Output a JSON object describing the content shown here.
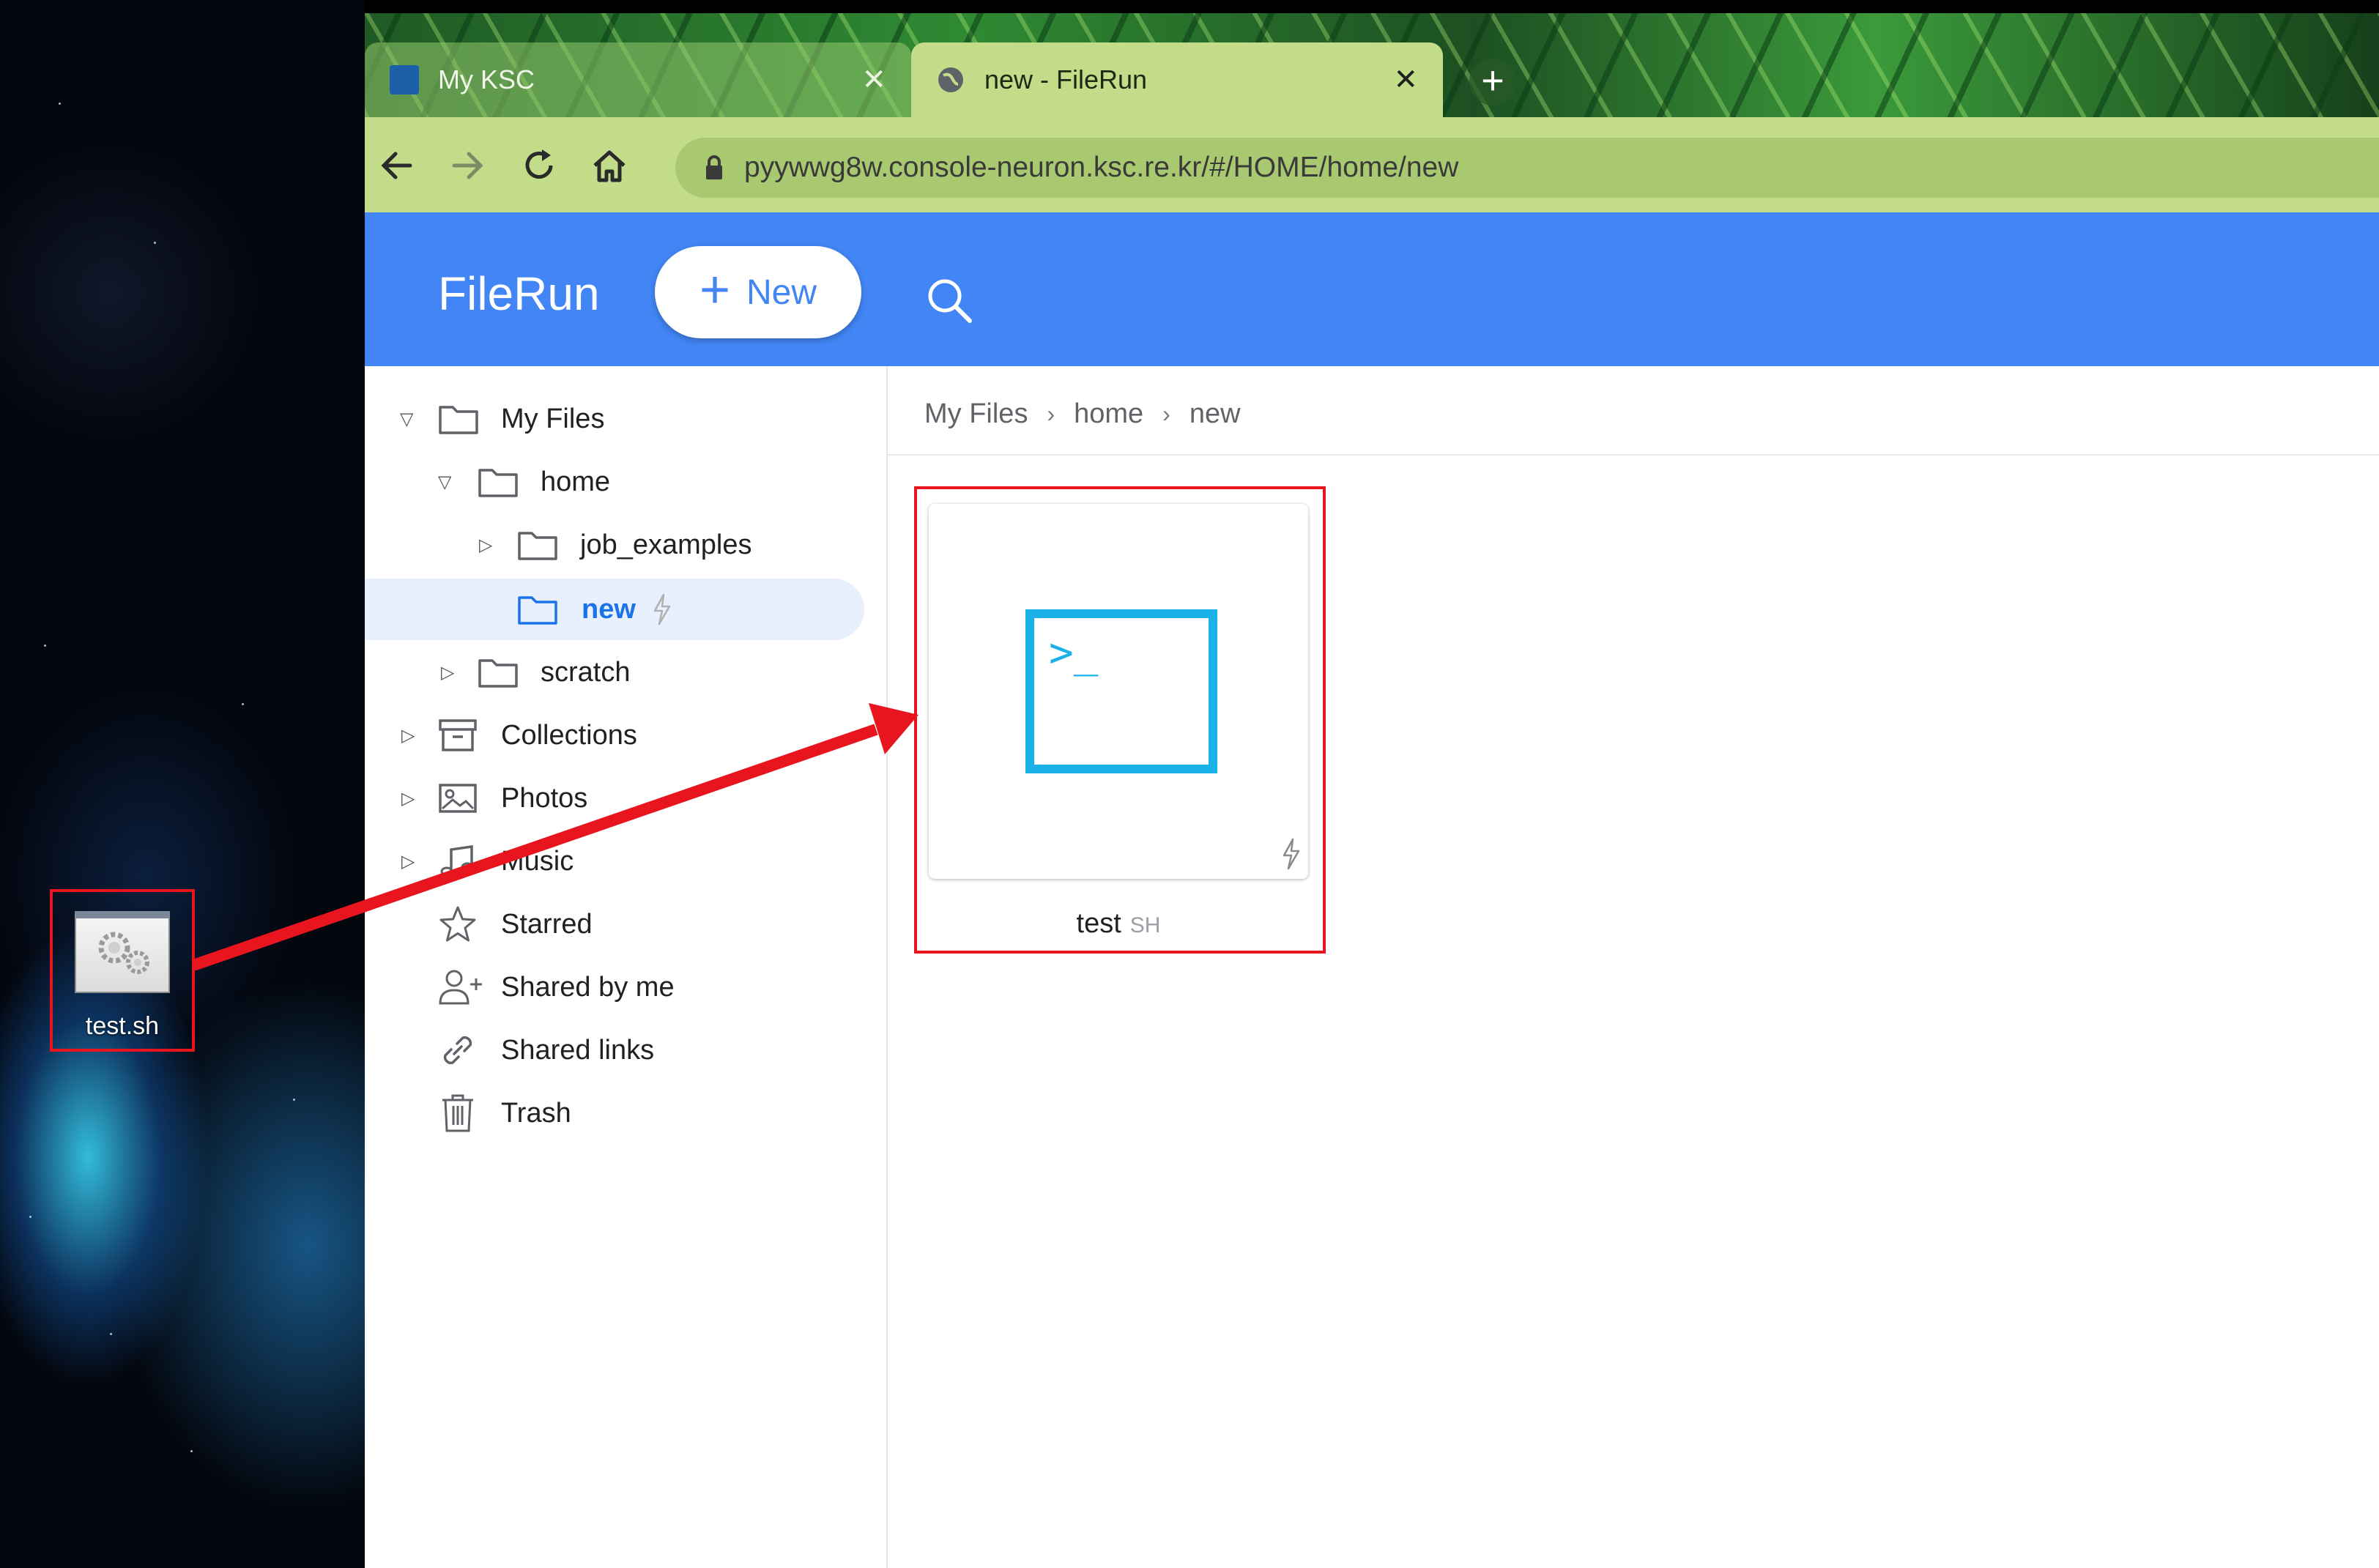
{
  "desktop": {
    "file_label": "test.sh"
  },
  "browser": {
    "tabs": [
      {
        "title": "My KSC",
        "close": "✕"
      },
      {
        "title": "new - FileRun",
        "close": "✕"
      }
    ],
    "new_tab": "+",
    "url": "pyywwg8w.console-neuron.ksc.re.kr/#/HOME/home/new"
  },
  "app": {
    "logo": "FileRun",
    "new_button": "New"
  },
  "sidebar": {
    "my_files": "My Files",
    "home": "home",
    "job_examples": "job_examples",
    "new": "new",
    "scratch": "scratch",
    "collections": "Collections",
    "photos": "Photos",
    "music": "Music",
    "starred": "Starred",
    "shared_by_me": "Shared by me",
    "shared_links": "Shared links",
    "trash": "Trash"
  },
  "breadcrumb": [
    "My Files",
    "home",
    "new"
  ],
  "file": {
    "name": "test",
    "ext": "SH",
    "preview_text": ">_"
  },
  "colors": {
    "header": "#4285f4",
    "selection": "#e8f0fe",
    "highlight": "#e8141e",
    "terminal_icon": "#1ab0e8"
  }
}
